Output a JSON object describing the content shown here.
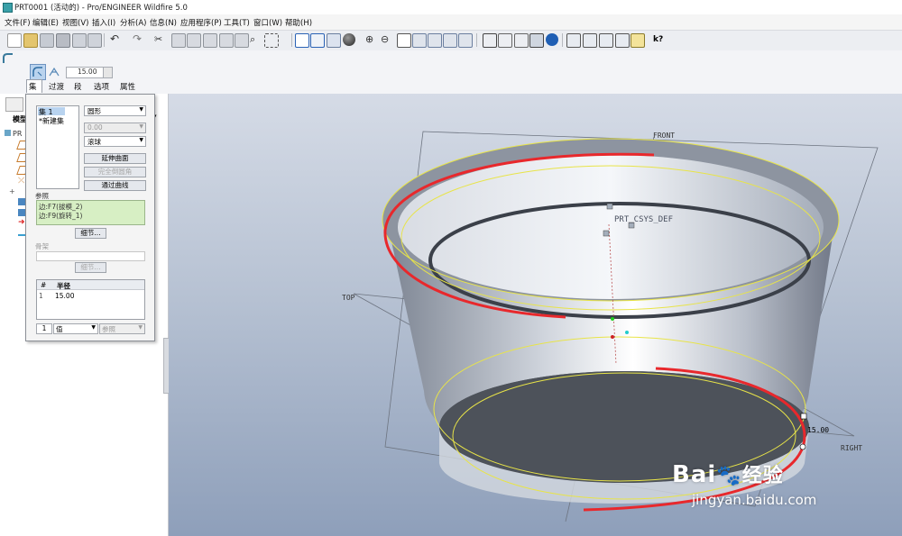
{
  "window": {
    "title": "PRT0001 (活动的) - Pro/ENGINEER Wildfire 5.0"
  },
  "menu": [
    "文件(F)",
    "编辑(E)",
    "视图(V)",
    "插入(I)",
    "分析(A)",
    "信息(N)",
    "应用程序(P)",
    "工具(T)",
    "窗口(W)",
    "帮助(H)"
  ],
  "dashboard": {
    "radius_value": "15.00",
    "tabs": [
      "集",
      "过渡",
      "段",
      "选项",
      "属性"
    ],
    "active_tab": "集"
  },
  "left_panel": {
    "tab_label": "模型",
    "tree_root": "PR"
  },
  "sets_panel": {
    "set_items": [
      "集 1",
      "*新建集"
    ],
    "shape_combo": "圆形",
    "value_combo": "0.00",
    "method_combo": "滚球",
    "extend_button": "延伸曲面",
    "full_round_button": "完全倒圆角",
    "through_curve_button": "通过曲线",
    "references_label": "参照",
    "references": [
      "边:F7(拔模_2)",
      "边:F9(旋转_1)"
    ],
    "details_button": "细节...",
    "spine_label": "骨架",
    "spine_details_button": "细节...",
    "radius_table": {
      "headers": [
        "#",
        "半径"
      ],
      "rows": [
        [
          "1",
          "15.00"
        ]
      ]
    },
    "bottom_index": "1",
    "bottom_value_combo": "值",
    "bottom_ref_combo": "参照"
  },
  "viewport": {
    "datum_labels": [
      "FRONT",
      "TOP",
      "RIGHT"
    ],
    "csys_label": "PRT_CSYS_DEF",
    "dimension_label": "15.00"
  },
  "watermark": {
    "brand": "Bai",
    "brand_suffix": "经验",
    "url": "jingyan.baidu.com"
  },
  "colors": {
    "selection_red": "#e8282c",
    "preview_yellow": "#e8e448",
    "viewport_top": "#d5dbe6",
    "viewport_bottom": "#8e9fba"
  }
}
